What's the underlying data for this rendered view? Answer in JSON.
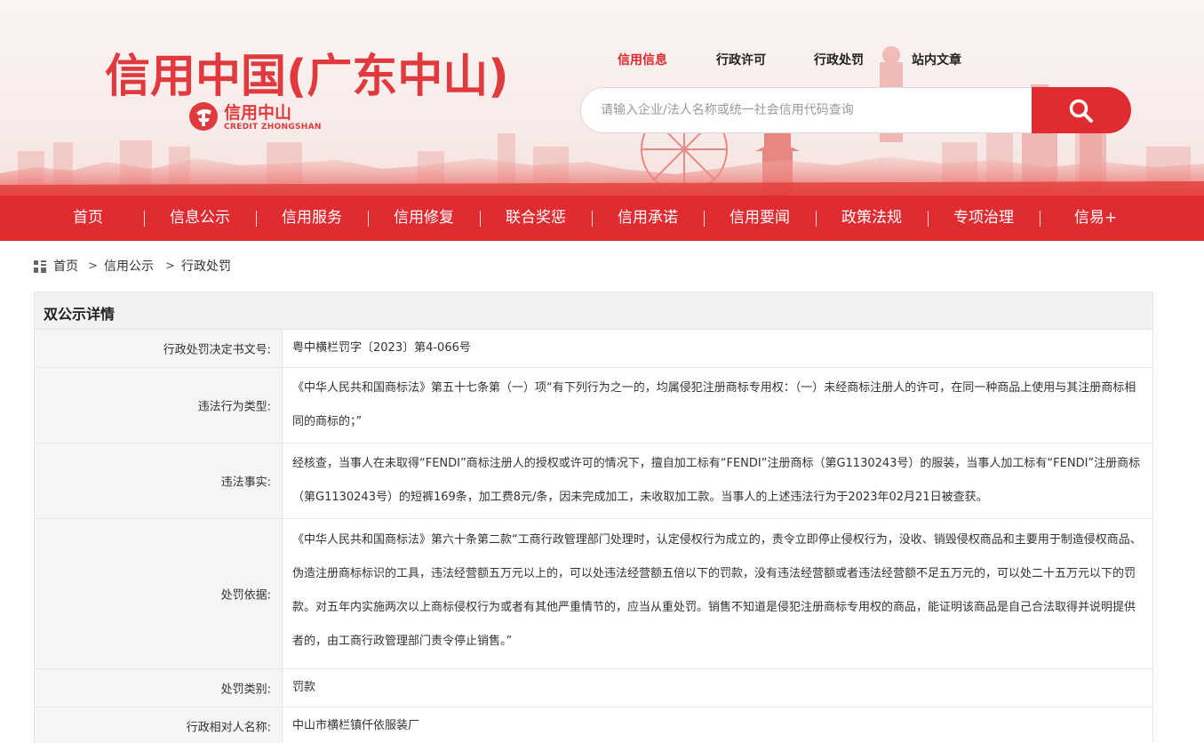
{
  "site": {
    "title": "信用中国(广东中山)",
    "logo_cn": "信用中山",
    "logo_en": "CREDIT ZHONGSHAN"
  },
  "top_nav": [
    {
      "label": "信用信息",
      "active": true
    },
    {
      "label": "行政许可",
      "active": false
    },
    {
      "label": "行政处罚",
      "active": false
    },
    {
      "label": "站内文章",
      "active": false
    }
  ],
  "search": {
    "placeholder": "请输入企业/法人名称或统一社会信用代码查询",
    "button_icon": "search-icon"
  },
  "main_nav": [
    "首页",
    "信息公示",
    "信用服务",
    "信用修复",
    "联合奖惩",
    "信用承诺",
    "信用要闻",
    "政策法规",
    "专项治理",
    "信易+"
  ],
  "breadcrumb": [
    "首页",
    "信用公示",
    "行政处罚"
  ],
  "detail": {
    "title": "双公示详情",
    "rows": [
      {
        "label": "行政处罚决定书文号:",
        "value": "粤中横栏罚字〔2023〕第4-066号"
      },
      {
        "label": "违法行为类型:",
        "value": "《中华人民共和国商标法》第五十七条第（一）项“有下列行为之一的，均属侵犯注册商标专用权：（一）未经商标注册人的许可，在同一种商品上使用与其注册商标相同的商标的；”"
      },
      {
        "label": "违法事实:",
        "value": "经核查，当事人在未取得“FENDI”商标注册人的授权或许可的情况下，擅自加工标有“FENDI”注册商标（第G1130243号）的服装，当事人加工标有“FENDI”注册商标（第G1130243号）的短裤169条，加工费8元/条，因未完成加工，未收取加工款。当事人的上述违法行为于2023年02月21日被查获。"
      },
      {
        "label": "处罚依据:",
        "value": "《中华人民共和国商标法》第六十条第二款“工商行政管理部门处理时，认定侵权行为成立的，责令立即停止侵权行为，没收、销毁侵权商品和主要用于制造侵权商品、伪造注册商标标识的工具，违法经营额五万元以上的，可以处违法经营额五倍以下的罚款，没有违法经营额或者违法经营额不足五万元的，可以处二十五万元以下的罚款。对五年内实施两次以上商标侵权行为或者有其他严重情节的，应当从重处罚。销售不知道是侵犯注册商标专用权的商品，能证明该商品是自己合法取得并说明提供者的，由工商行政管理部门责令停止销售。”"
      },
      {
        "label": "处罚类别:",
        "value": "罚款"
      },
      {
        "label": "行政相对人名称:",
        "value": "中山市横栏镇仟依服装厂"
      }
    ]
  },
  "colors": {
    "brand_red": "#e02b30",
    "title_red": "#e03a3e",
    "label_bg": "#f5f5f5",
    "border": "#e6e6e6"
  }
}
